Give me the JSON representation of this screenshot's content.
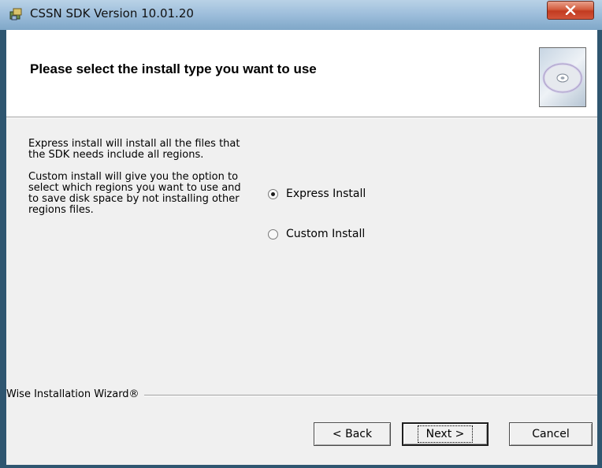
{
  "window": {
    "title": "CSSN SDK Version 10.01.20",
    "close_label": "x"
  },
  "header": {
    "title": "Please select the install type you want to use",
    "image": "cd-disc-icon"
  },
  "description": {
    "express": "Express install will install all the files that the SDK needs include all regions.",
    "custom": "Custom install will give you the option to select which regions you want to use and to save disk space by not installing other regions files."
  },
  "options": [
    {
      "label": "Express Install",
      "checked": true
    },
    {
      "label": "Custom Install",
      "checked": false
    }
  ],
  "footer": {
    "brand": "Wise Installation Wizard®"
  },
  "buttons": {
    "back": "< Back",
    "next": "Next >",
    "cancel": "Cancel"
  },
  "colors": {
    "titlebar": "#9fbfdc",
    "close": "#c23b20",
    "dialog_bg": "#f0f0f0",
    "header_bg": "#ffffff"
  }
}
